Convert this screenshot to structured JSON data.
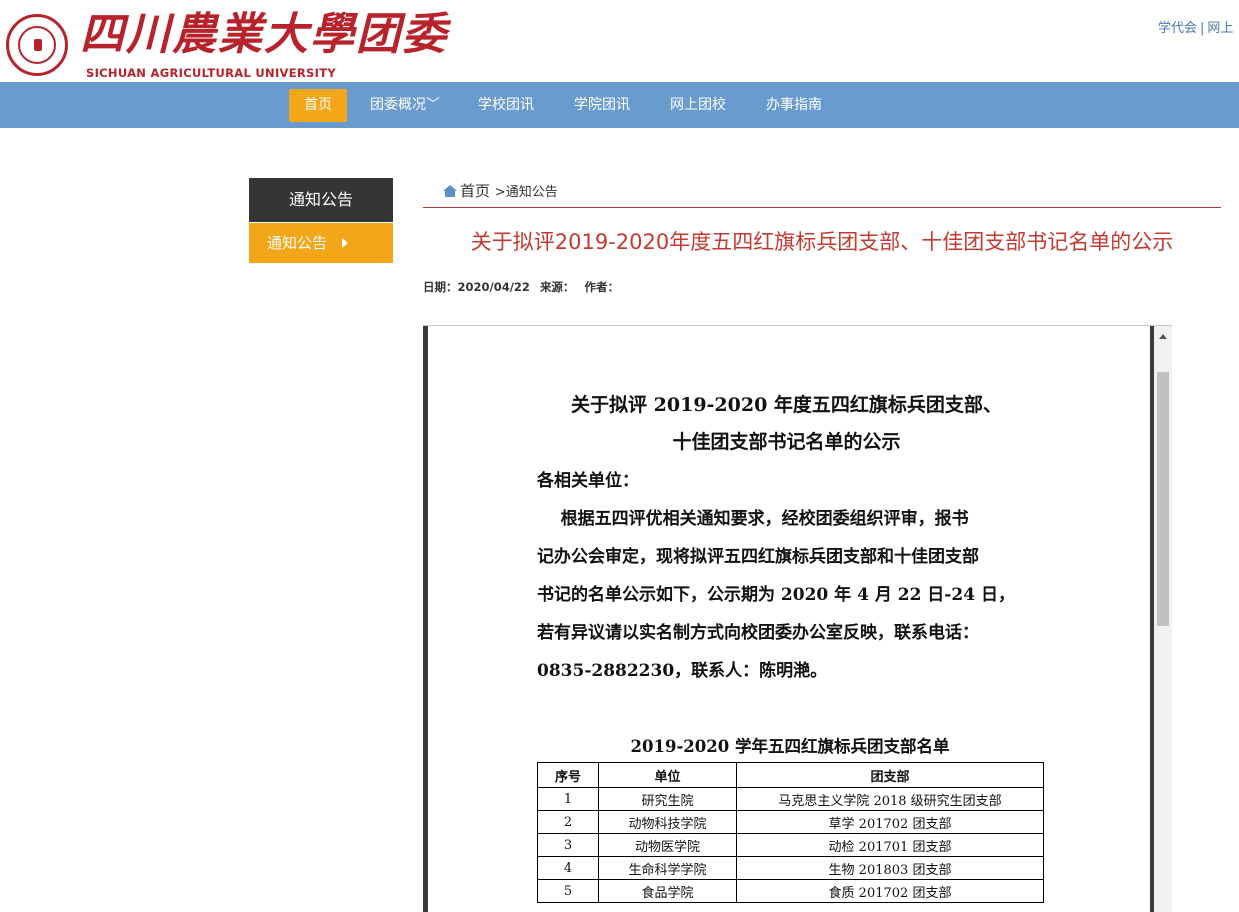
{
  "header": {
    "logo_cn": "四川農業大學团委",
    "logo_en": "SICHUAN AGRICULTURAL UNIVERSITY",
    "top_links": [
      "学代会",
      "网上"
    ]
  },
  "nav": {
    "items": [
      "首页",
      "团委概况﹀",
      "学校团讯",
      "学院团讯",
      "网上团校",
      "办事指南"
    ]
  },
  "sidebar": {
    "title": "通知公告",
    "item": "通知公告"
  },
  "breadcrumb": {
    "home": "首页",
    "current": ">通知公告"
  },
  "article": {
    "title": "关于拟评2019-2020年度五四红旗标兵团支部、十佳团支部书记名单的公示",
    "meta": {
      "date": "日期：2020/04/22",
      "source": "来源：",
      "author": "作者："
    }
  },
  "document": {
    "title_line1": "关于拟评 2019-2020 年度五四红旗标兵团支部、",
    "title_line2": "十佳团支部书记名单的公示",
    "salutation": "各相关单位：",
    "body_lines": [
      "    根据五四评优相关通知要求，经校团委组织评审，报书",
      "记办公会审定，现将拟评五四红旗标兵团支部和十佳团支部",
      "书记的名单公示如下，公示期为 2020 年 4 月 22 日-24 日，",
      "若有异议请以实名制方式向校团委办公室反映，联系电话：",
      "0835-2882230，联系人：陈明滟。"
    ],
    "table_caption": "2019-2020 学年五四红旗标兵团支部名单",
    "table": {
      "headers": [
        "序号",
        "单位",
        "团支部"
      ],
      "rows": [
        [
          "1",
          "研究生院",
          "马克思主义学院 2018 级研究生团支部"
        ],
        [
          "2",
          "动物科技学院",
          "草学 201702 团支部"
        ],
        [
          "3",
          "动物医学院",
          "动检 201701 团支部"
        ],
        [
          "4",
          "生命科学学院",
          "生物 201803 团支部"
        ],
        [
          "5",
          "食品学院",
          "食质 201702 团支部"
        ]
      ]
    }
  }
}
